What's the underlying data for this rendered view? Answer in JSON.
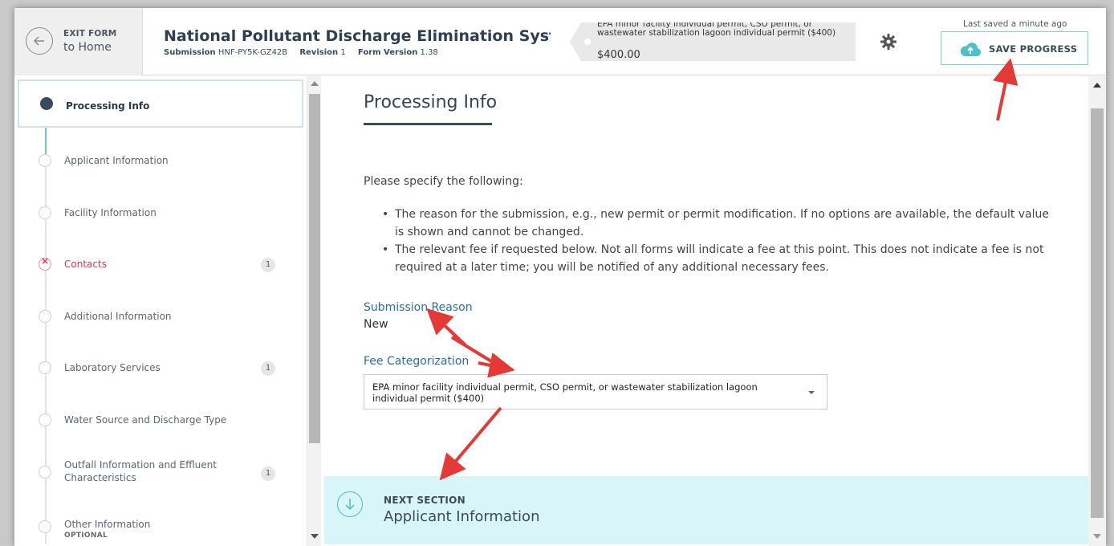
{
  "header": {
    "exit_line1": "EXIT FORM",
    "exit_line2": "to Home",
    "title": "National Pollutant Discharge Elimination System (NPDES)",
    "submission_label": "Submission",
    "submission_id": "HNF-PY5K-GZ42B",
    "revision_label": "Revision",
    "revision": "1",
    "form_version_label": "Form Version",
    "form_version": "1.38",
    "fee_text": "EPA minor facility individual permit, CSO permit, or wastewater stabilization lagoon individual permit ($400)",
    "fee_amount": "$400.00",
    "last_saved": "Last saved a minute ago",
    "save_label": "SAVE PROGRESS"
  },
  "sidebar": {
    "items": [
      {
        "label": "Processing Info",
        "state": "active",
        "badge": ""
      },
      {
        "label": "Applicant Information",
        "state": "normal",
        "badge": ""
      },
      {
        "label": "Facility Information",
        "state": "normal",
        "badge": ""
      },
      {
        "label": "Contacts",
        "state": "error",
        "badge": "1"
      },
      {
        "label": "Additional Information",
        "state": "normal",
        "badge": ""
      },
      {
        "label": "Laboratory Services",
        "state": "normal",
        "badge": "1"
      },
      {
        "label": "Water Source and Discharge Type",
        "state": "normal",
        "badge": ""
      },
      {
        "label": "Outfall Information and Effluent",
        "label2": "Characteristics",
        "state": "normal",
        "badge": "1"
      },
      {
        "label": "Other Information",
        "sublabel": "OPTIONAL",
        "state": "normal",
        "badge": ""
      }
    ]
  },
  "main": {
    "title": "Processing Info",
    "intro": "Please specify the following:",
    "bullets": [
      "The reason for the submission, e.g., new permit or permit modification. If no options are available, the default value is shown and cannot be changed.",
      "The relevant fee if requested below. Not all forms will indicate a fee at this point. This does not indicate a fee is not required at a later time; you will be notified of any additional necessary fees."
    ],
    "submission_reason_label": "Submission Reason",
    "submission_reason_value": "New",
    "fee_label": "Fee Categorization",
    "fee_selected": "EPA minor facility individual permit, CSO permit, or wastewater stabilization lagoon individual permit ($400)"
  },
  "next_section": {
    "label": "NEXT SECTION",
    "title": "Applicant Information"
  },
  "colors": {
    "accent_teal": "#6ac7cf",
    "next_bg": "#d8f6f8",
    "error_red": "#e0364b",
    "label_blue": "#2a6fa0",
    "annotation_red": "#e53935"
  }
}
